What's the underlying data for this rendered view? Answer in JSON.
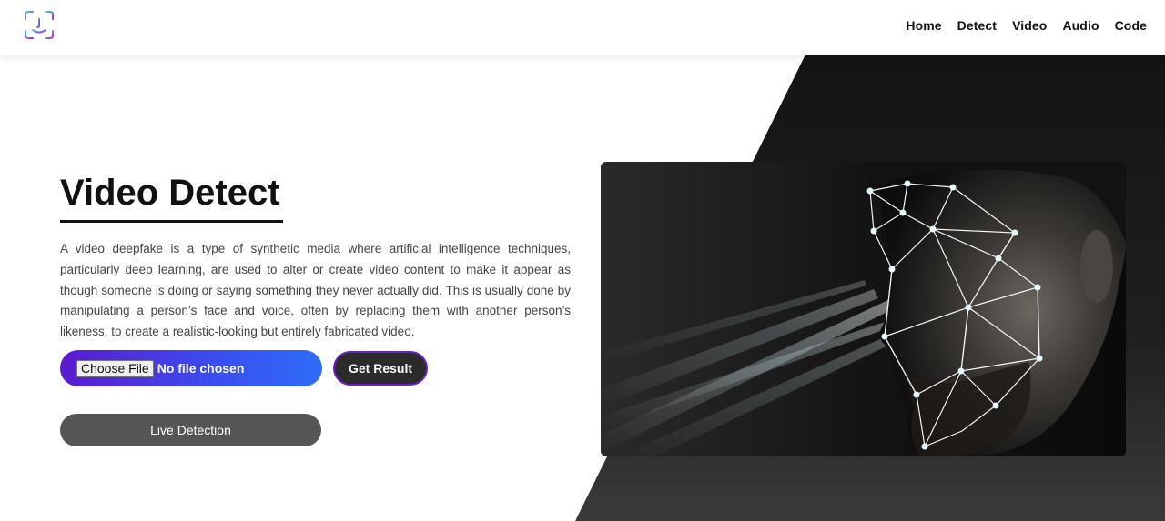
{
  "nav": {
    "items": [
      "Home",
      "Detect",
      "Video",
      "Audio",
      "Code"
    ]
  },
  "hero": {
    "title": "Video Detect",
    "description": "A video deepfake is a type of synthetic media where artificial intelligence techniques, particularly deep learning, are used to alter or create video content to make it appear as though someone is doing or saying something they never actually did. This is usually done by manipulating a person’s face and voice, often by replacing them with another person’s likeness, to create a realistic-looking but entirely fabricated video."
  },
  "upload": {
    "choose_label": "Choose File",
    "status": "No file chosen"
  },
  "actions": {
    "get_result": "Get Result",
    "live_detection": "Live Detection"
  },
  "icons": {
    "logo": "face-id-icon"
  },
  "colors": {
    "gradient_start": "#5b1ad0",
    "gradient_end": "#2f6cf8",
    "dark_bg": "#1c1c1c"
  }
}
